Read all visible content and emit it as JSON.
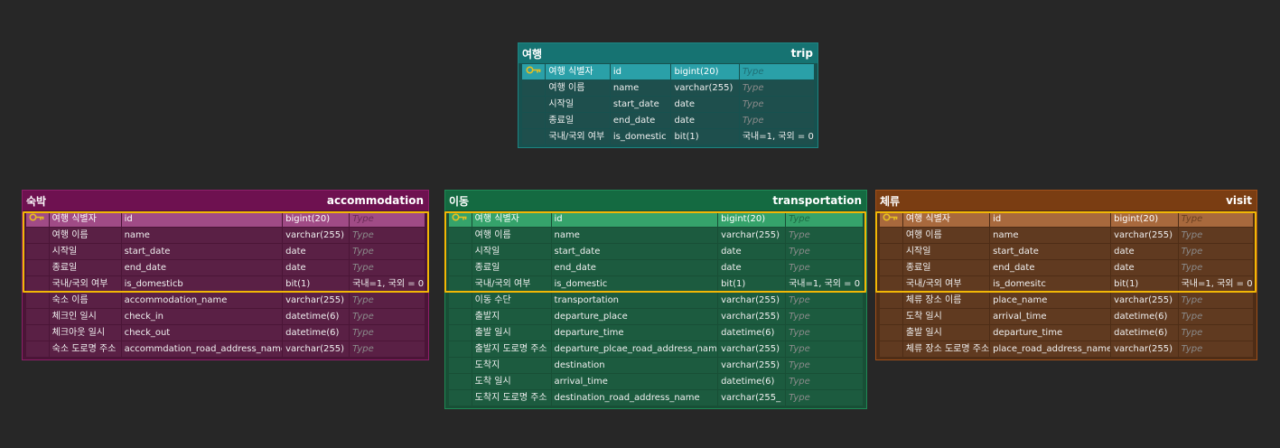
{
  "tables": {
    "trip": {
      "title_ko": "여행",
      "title_en": "trip",
      "rows": [
        {
          "pk": true,
          "label": "여행 식별자",
          "column": "id",
          "datatype": "bigint(20)",
          "note": "Type"
        },
        {
          "pk": false,
          "label": "여행 이름",
          "column": "name",
          "datatype": "varchar(255)",
          "note": "Type"
        },
        {
          "pk": false,
          "label": "시작일",
          "column": "start_date",
          "datatype": "date",
          "note": "Type"
        },
        {
          "pk": false,
          "label": "종료일",
          "column": "end_date",
          "datatype": "date",
          "note": "Type"
        },
        {
          "pk": false,
          "label": "국내/국외 여부",
          "column": "is_domestic",
          "datatype": "bit(1)",
          "note": "국내=1, 국외 = 0"
        }
      ]
    },
    "accommodation": {
      "title_ko": "숙박",
      "title_en": "accommodation",
      "rows": [
        {
          "pk": true,
          "label": "여행 식별자",
          "column": "id",
          "datatype": "bigint(20)",
          "note": "Type"
        },
        {
          "pk": false,
          "label": "여행 이름",
          "column": "name",
          "datatype": "varchar(255)",
          "note": "Type"
        },
        {
          "pk": false,
          "label": "시작일",
          "column": "start_date",
          "datatype": "date",
          "note": "Type"
        },
        {
          "pk": false,
          "label": "종료일",
          "column": "end_date",
          "datatype": "date",
          "note": "Type"
        },
        {
          "pk": false,
          "label": "국내/국외 여부",
          "column": "is_domesticb",
          "datatype": "bit(1)",
          "note": "국내=1, 국외 = 0"
        },
        {
          "pk": false,
          "label": "숙소 이름",
          "column": "accommodation_name",
          "datatype": "varchar(255)",
          "note": "Type"
        },
        {
          "pk": false,
          "label": "체크인 일시",
          "column": "check_in",
          "datatype": "datetime(6)",
          "note": "Type"
        },
        {
          "pk": false,
          "label": "체크아웃 일시",
          "column": "check_out",
          "datatype": "datetime(6)",
          "note": "Type"
        },
        {
          "pk": false,
          "label": "숙소 도로명 주소",
          "column": "accommdation_road_address_name",
          "datatype": "varchar(255)",
          "note": "Type"
        }
      ]
    },
    "transportation": {
      "title_ko": "이동",
      "title_en": "transportation",
      "rows": [
        {
          "pk": true,
          "label": "여행 식별자",
          "column": "id",
          "datatype": "bigint(20)",
          "note": "Type"
        },
        {
          "pk": false,
          "label": "여행 이름",
          "column": "name",
          "datatype": "varchar(255)",
          "note": "Type"
        },
        {
          "pk": false,
          "label": "시작일",
          "column": "start_date",
          "datatype": "date",
          "note": "Type"
        },
        {
          "pk": false,
          "label": "종료일",
          "column": "end_date",
          "datatype": "date",
          "note": "Type"
        },
        {
          "pk": false,
          "label": "국내/국외 여부",
          "column": "is_domestic",
          "datatype": "bit(1)",
          "note": "국내=1, 국외 = 0"
        },
        {
          "pk": false,
          "label": "이동 수단",
          "column": "transportation",
          "datatype": "varchar(255)",
          "note": "Type"
        },
        {
          "pk": false,
          "label": "출발지",
          "column": "departure_place",
          "datatype": "varchar(255)",
          "note": "Type"
        },
        {
          "pk": false,
          "label": "출발 일시",
          "column": "departure_time",
          "datatype": "datetime(6)",
          "note": "Type"
        },
        {
          "pk": false,
          "label": "출발지 도로명 주소",
          "column": "departure_plcae_road_address_name",
          "datatype": "varchar(255)",
          "note": "Type"
        },
        {
          "pk": false,
          "label": "도착지",
          "column": "destination",
          "datatype": "varchar(255)",
          "note": "Type"
        },
        {
          "pk": false,
          "label": "도착 일시",
          "column": "arrival_time",
          "datatype": "datetime(6)",
          "note": "Type"
        },
        {
          "pk": false,
          "label": "도착지 도로명 주소",
          "column": "destination_road_address_name",
          "datatype": "varchar(255_",
          "note": "Type"
        }
      ]
    },
    "visit": {
      "title_ko": "체류",
      "title_en": "visit",
      "rows": [
        {
          "pk": true,
          "label": "여행 식별자",
          "column": "id",
          "datatype": "bigint(20)",
          "note": "Type"
        },
        {
          "pk": false,
          "label": "여행 이름",
          "column": "name",
          "datatype": "varchar(255)",
          "note": "Type"
        },
        {
          "pk": false,
          "label": "시작일",
          "column": "start_date",
          "datatype": "date",
          "note": "Type"
        },
        {
          "pk": false,
          "label": "종료일",
          "column": "end_date",
          "datatype": "date",
          "note": "Type"
        },
        {
          "pk": false,
          "label": "국내/국외 여부",
          "column": "is_domesitc",
          "datatype": "bit(1)",
          "note": "국내=1, 국외 = 0"
        },
        {
          "pk": false,
          "label": "체류 장소 이름",
          "column": "place_name",
          "datatype": "varchar(255)",
          "note": "Type"
        },
        {
          "pk": false,
          "label": "도착 일시",
          "column": "arrival_time",
          "datatype": "datetime(6)",
          "note": "Type"
        },
        {
          "pk": false,
          "label": "출발 일시",
          "column": "departure_time",
          "datatype": "datetime(6)",
          "note": "Type"
        },
        {
          "pk": false,
          "label": "체류 장소 도로명 주소",
          "column": "place_road_address_name",
          "datatype": "varchar(255)",
          "note": "Type"
        }
      ]
    }
  },
  "colors": {
    "highlight": "#f2b705",
    "key_icon": "#e8c020",
    "placeholder_text": "#8b8b8b"
  },
  "icons": {
    "primary_key": "key-icon"
  }
}
